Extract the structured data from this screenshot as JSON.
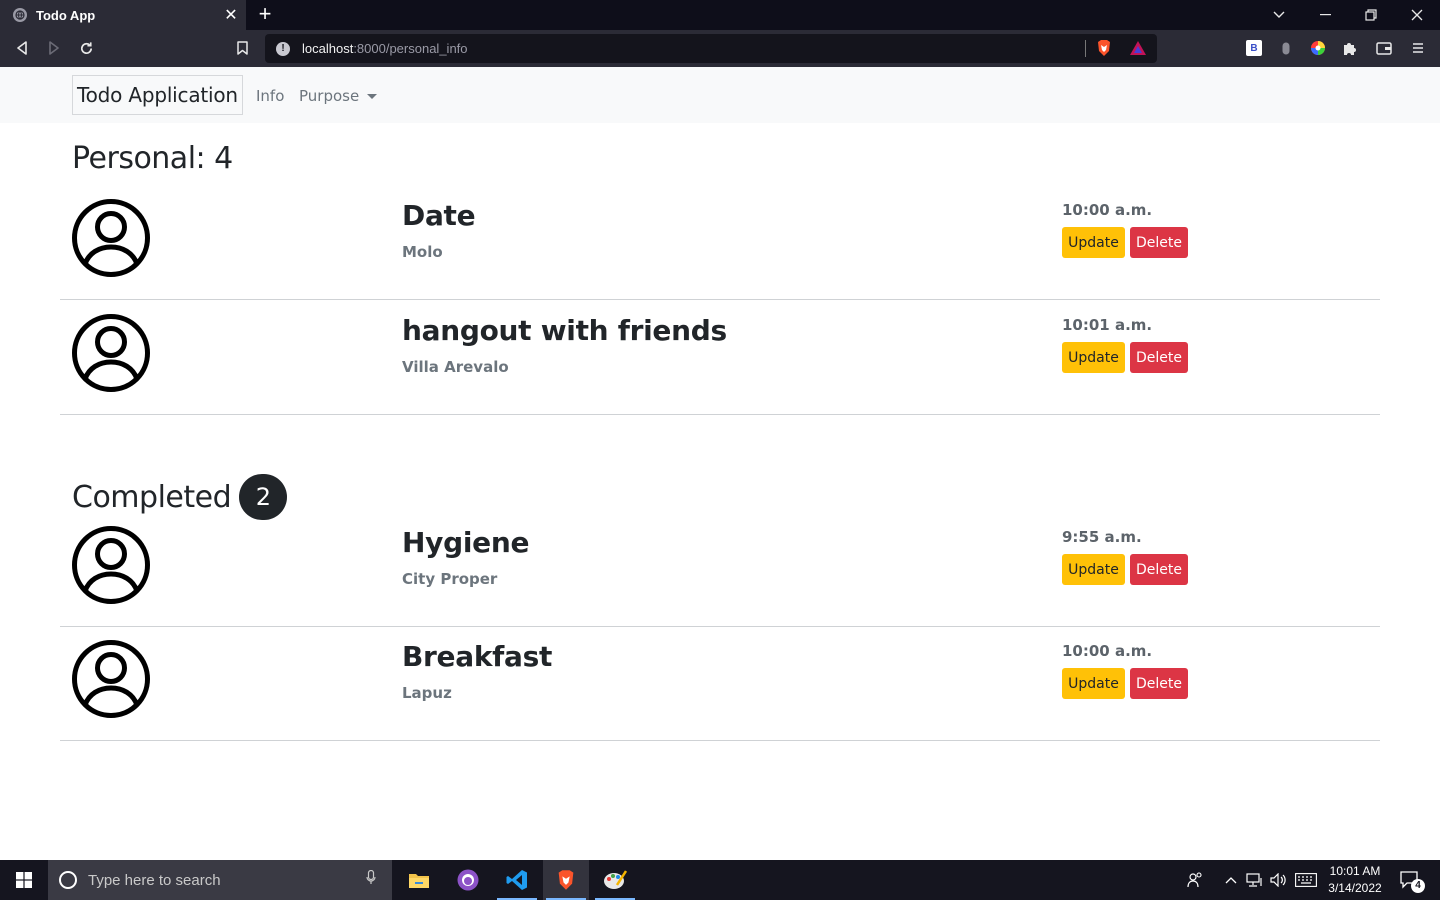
{
  "browser": {
    "tab_title": "Todo App",
    "url_host": "localhost",
    "url_path": ":8000/personal_info",
    "ext_b_label": "B"
  },
  "navbar": {
    "brand": "Todo Application",
    "link_info": "Info",
    "link_purpose": "Purpose"
  },
  "personal": {
    "heading": "Personal: 4",
    "items": [
      {
        "title": "Date",
        "place": "Molo",
        "time": "10:00 a.m."
      },
      {
        "title": "hangout with friends",
        "place": "Villa Arevalo",
        "time": "10:01 a.m."
      }
    ]
  },
  "completed": {
    "heading": "Completed",
    "count": "2",
    "items": [
      {
        "title": "Hygiene",
        "place": "City Proper",
        "time": "9:55 a.m."
      },
      {
        "title": "Breakfast",
        "place": "Lapuz",
        "time": "10:00 a.m."
      }
    ]
  },
  "buttons": {
    "update": "Update",
    "delete": "Delete"
  },
  "colors": {
    "update": "#ffc107",
    "delete": "#dc3545",
    "badge": "#212529"
  },
  "taskbar": {
    "search_placeholder": "Type here to search",
    "time": "10:01 AM",
    "date": "3/14/2022",
    "notification_count": "4"
  }
}
